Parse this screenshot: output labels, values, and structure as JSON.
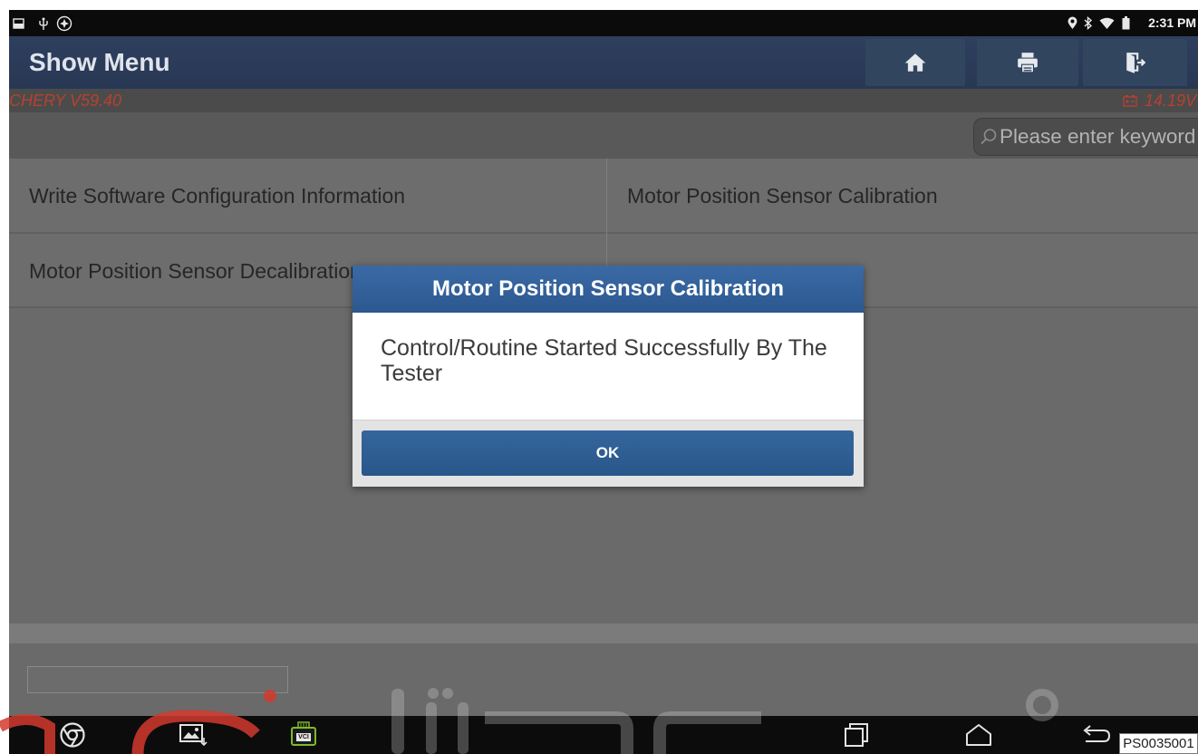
{
  "status_bar": {
    "time": "2:31 PM",
    "left_icons": [
      "screenshot-icon",
      "usb-debug-icon",
      "settings-alert-icon"
    ],
    "right_icons": [
      "location-icon",
      "bluetooth-icon",
      "wifi-icon",
      "battery-icon"
    ]
  },
  "header": {
    "title": "Show Menu",
    "buttons": [
      {
        "icon": "home-icon"
      },
      {
        "icon": "print-icon"
      },
      {
        "icon": "exit-icon"
      }
    ]
  },
  "info_bar": {
    "software_version": "CHERY V59.40",
    "voltage": "14.19V",
    "voltage_icon": "battery-voltage-icon"
  },
  "search": {
    "placeholder": "Please enter keyword",
    "value": "",
    "icon": "search-icon"
  },
  "menu": {
    "items": [
      {
        "label": "Write Software Configuration Information"
      },
      {
        "label": "Motor Position Sensor Calibration"
      },
      {
        "label": "Motor Position Sensor Decalibration"
      },
      {
        "label": ""
      }
    ]
  },
  "dialog": {
    "title": "Motor Position Sensor Calibration",
    "message": "Control/Routine Started Successfully By The Tester",
    "ok_label": "OK"
  },
  "nav_bar": {
    "app_icons": [
      {
        "icon": "chrome-icon"
      },
      {
        "icon": "gallery-icon"
      },
      {
        "icon": "vci-icon",
        "label": "VCI"
      }
    ],
    "system_icons": [
      "recent-apps-icon",
      "home-nav-icon",
      "back-icon"
    ]
  },
  "figure_label": "PS0035001",
  "colors": {
    "header_bg": "#2b3b57",
    "info_text": "#b7412f",
    "dialog_title_bg": "#2f5b94",
    "ok_button_bg": "#2e5d97",
    "vci_accent": "#7dba2c"
  }
}
